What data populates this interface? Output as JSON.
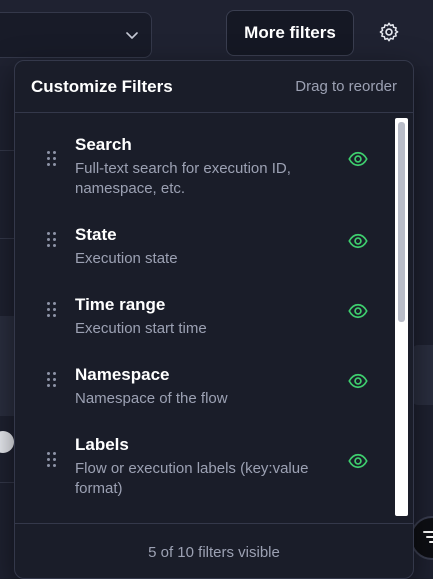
{
  "toolbar": {
    "more_filters_label": "More filters",
    "settings_icon": "gear-icon",
    "select_icon": "chevron-down-icon"
  },
  "panel": {
    "title": "Customize Filters",
    "hint": "Drag to reorder",
    "footer": "5 of 10 filters visible",
    "items": [
      {
        "name": "Search",
        "description": "Full-text search for execution ID, namespace, etc.",
        "visible": true
      },
      {
        "name": "State",
        "description": "Execution state",
        "visible": true
      },
      {
        "name": "Time range",
        "description": "Execution start time",
        "visible": true
      },
      {
        "name": "Namespace",
        "description": "Namespace of the flow",
        "visible": true
      },
      {
        "name": "Labels",
        "description": "Flow or execution labels (key:value format)",
        "visible": true
      }
    ]
  },
  "colors": {
    "accent_visible": "#3ecf6e",
    "panel_bg": "#1a1d29",
    "page_bg": "#1e2130"
  }
}
